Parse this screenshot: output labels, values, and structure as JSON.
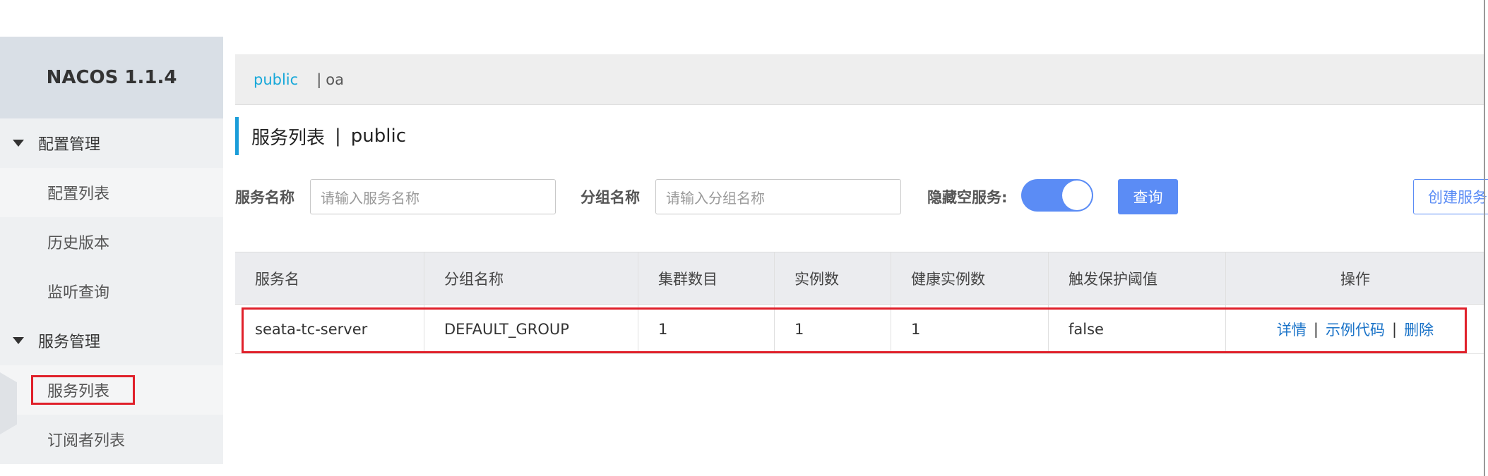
{
  "sidebar": {
    "brand": "NACOS 1.1.4",
    "groups": [
      {
        "label": "配置管理",
        "items": [
          "配置列表",
          "历史版本",
          "监听查询"
        ]
      },
      {
        "label": "服务管理",
        "items": [
          "服务列表",
          "订阅者列表"
        ]
      }
    ],
    "active_item": "服务列表"
  },
  "namespaces": {
    "active": "public",
    "separator": "|",
    "other": "oa"
  },
  "page": {
    "title": "服务列表",
    "title_sep": "|",
    "namespace": "public"
  },
  "filters": {
    "service_label": "服务名称",
    "service_placeholder": "请输入服务名称",
    "group_label": "分组名称",
    "group_placeholder": "请输入分组名称",
    "hide_empty_label": "隐藏空服务:",
    "hide_empty_on": true,
    "query_button": "查询",
    "create_button": "创建服务"
  },
  "table": {
    "headers": [
      "服务名",
      "分组名称",
      "集群数目",
      "实例数",
      "健康实例数",
      "触发保护阈值",
      "操作"
    ],
    "rows": [
      {
        "service": "seata-tc-server",
        "group": "DEFAULT_GROUP",
        "clusters": "1",
        "instances": "1",
        "healthy": "1",
        "threshold": "false",
        "actions": [
          "详情",
          "示例代码",
          "删除"
        ]
      }
    ],
    "action_sep": "|"
  },
  "colors": {
    "accent": "#5b8cf5",
    "link": "#1a73c8",
    "ns_active": "#17a8d9",
    "highlight": "#e0202a"
  }
}
